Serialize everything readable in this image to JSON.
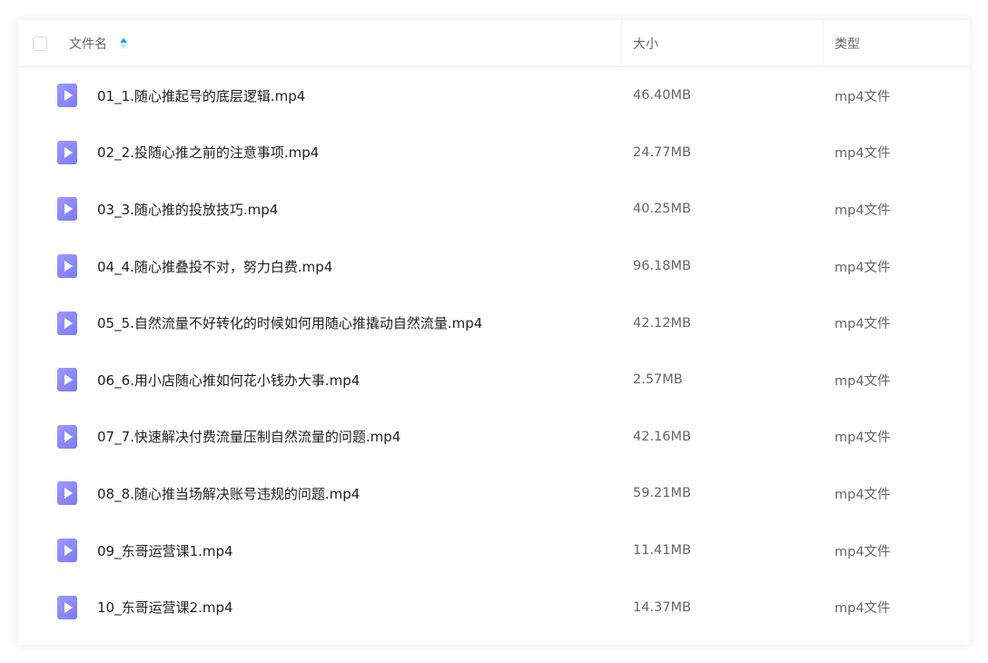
{
  "header": {
    "name_label": "文件名",
    "size_label": "大小",
    "type_label": "类型"
  },
  "files": [
    {
      "name": "01_1.随心推起号的底层逻辑.mp4",
      "size": "46.40MB",
      "type": "mp4文件"
    },
    {
      "name": "02_2.投随心推之前的注意事项.mp4",
      "size": "24.77MB",
      "type": "mp4文件"
    },
    {
      "name": "03_3.随心推的投放技巧.mp4",
      "size": "40.25MB",
      "type": "mp4文件"
    },
    {
      "name": "04_4.随心推叠投不对，努力白费.mp4",
      "size": "96.18MB",
      "type": "mp4文件"
    },
    {
      "name": "05_5.自然流量不好转化的时候如何用随心推撬动自然流量.mp4",
      "size": "42.12MB",
      "type": "mp4文件"
    },
    {
      "name": "06_6.用小店随心推如何花小钱办大事.mp4",
      "size": "2.57MB",
      "type": "mp4文件"
    },
    {
      "name": "07_7.快速解决付费流量压制自然流量的问题.mp4",
      "size": "42.16MB",
      "type": "mp4文件"
    },
    {
      "name": "08_8.随心推当场解决账号违规的问题.mp4",
      "size": "59.21MB",
      "type": "mp4文件"
    },
    {
      "name": "09_东哥运营课1.mp4",
      "size": "11.41MB",
      "type": "mp4文件"
    },
    {
      "name": "10_东哥运营课2.mp4",
      "size": "14.37MB",
      "type": "mp4文件"
    }
  ],
  "icons": {
    "file": "video-file-icon",
    "sort": "sort-ascending-icon"
  },
  "colors": {
    "sort_active": "#06a7ff",
    "file_icon": "#8a88f8"
  }
}
